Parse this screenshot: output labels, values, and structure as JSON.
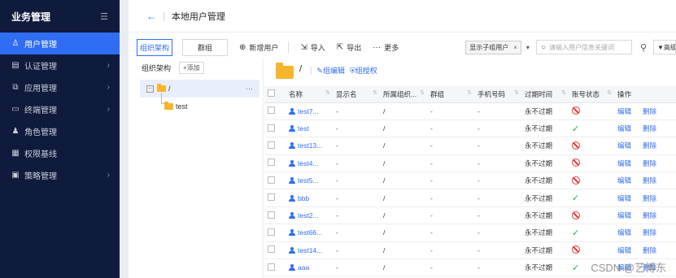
{
  "sidebar": {
    "title": "业务管理",
    "collapse_icon": "menu-fold-icon",
    "items": [
      {
        "label": "用户管理",
        "icon": "user-icon",
        "active": true
      },
      {
        "label": "认证管理",
        "icon": "auth-icon",
        "has_children": true
      },
      {
        "label": "应用管理",
        "icon": "app-icon",
        "has_children": true
      },
      {
        "label": "终端管理",
        "icon": "terminal-icon",
        "has_children": true
      },
      {
        "label": "角色管理",
        "icon": "role-icon"
      },
      {
        "label": "权限基线",
        "icon": "baseline-icon"
      },
      {
        "label": "策略管理",
        "icon": "policy-icon",
        "has_children": true
      }
    ]
  },
  "header": {
    "back": "←",
    "title": "本地用户管理"
  },
  "toolbar": {
    "tabs": [
      "组织架构",
      "群组"
    ],
    "add_user": "新增用户",
    "import": "导入",
    "export": "导出",
    "more": "更多",
    "filter_tag": "显示子组用户",
    "search_placeholder": "请输入用户信息关键词",
    "advanced": "高级"
  },
  "tree": {
    "title": "组织架构",
    "add": "+添加",
    "root": "/",
    "child": "test"
  },
  "org": {
    "path": "/",
    "edit": "组编辑",
    "auth": "组授权"
  },
  "table": {
    "headers": [
      "名称",
      "显示名",
      "所属组织...",
      "群组",
      "手机号码",
      "过期时间",
      "账号状态",
      "操作"
    ],
    "rows": [
      {
        "name": "test7...",
        "display": "-",
        "org": "/",
        "group": "-",
        "phone": "-",
        "expire": "永不过期",
        "status": "disabled"
      },
      {
        "name": "test",
        "display": "-",
        "org": "/",
        "group": "-",
        "phone": "-",
        "expire": "永不过期",
        "status": "enabled"
      },
      {
        "name": "test13...",
        "display": "-",
        "org": "/",
        "group": "-",
        "phone": "-",
        "expire": "永不过期",
        "status": "disabled"
      },
      {
        "name": "test4...",
        "display": "-",
        "org": "/",
        "group": "-",
        "phone": "-",
        "expire": "永不过期",
        "status": "disabled"
      },
      {
        "name": "test5...",
        "display": "-",
        "org": "/",
        "group": "-",
        "phone": "-",
        "expire": "永不过期",
        "status": "disabled"
      },
      {
        "name": "bbb",
        "display": "-",
        "org": "/",
        "group": "-",
        "phone": "-",
        "expire": "永不过期",
        "status": "enabled"
      },
      {
        "name": "test2...",
        "display": "-",
        "org": "/",
        "group": "-",
        "phone": "-",
        "expire": "永不过期",
        "status": "disabled"
      },
      {
        "name": "test66...",
        "display": "-",
        "org": "/",
        "group": "-",
        "phone": "-",
        "expire": "永不过期",
        "status": "enabled"
      },
      {
        "name": "test14...",
        "display": "-",
        "org": "/",
        "group": "-",
        "phone": "-",
        "expire": "永不过期",
        "status": "disabled"
      },
      {
        "name": "aaa",
        "display": "-",
        "org": "/",
        "group": "-",
        "phone": "-",
        "expire": "永不过期",
        "status": "enabled"
      }
    ],
    "edit": "编辑",
    "delete": "删除"
  },
  "watermark": "CSDN @艺博东",
  "colors": {
    "accent": "#2f6ef2",
    "sidebar_bg": "#0f1b3c",
    "ok": "#19b34a",
    "disabled": "#e23a3a",
    "folder": "#f7b52c"
  }
}
